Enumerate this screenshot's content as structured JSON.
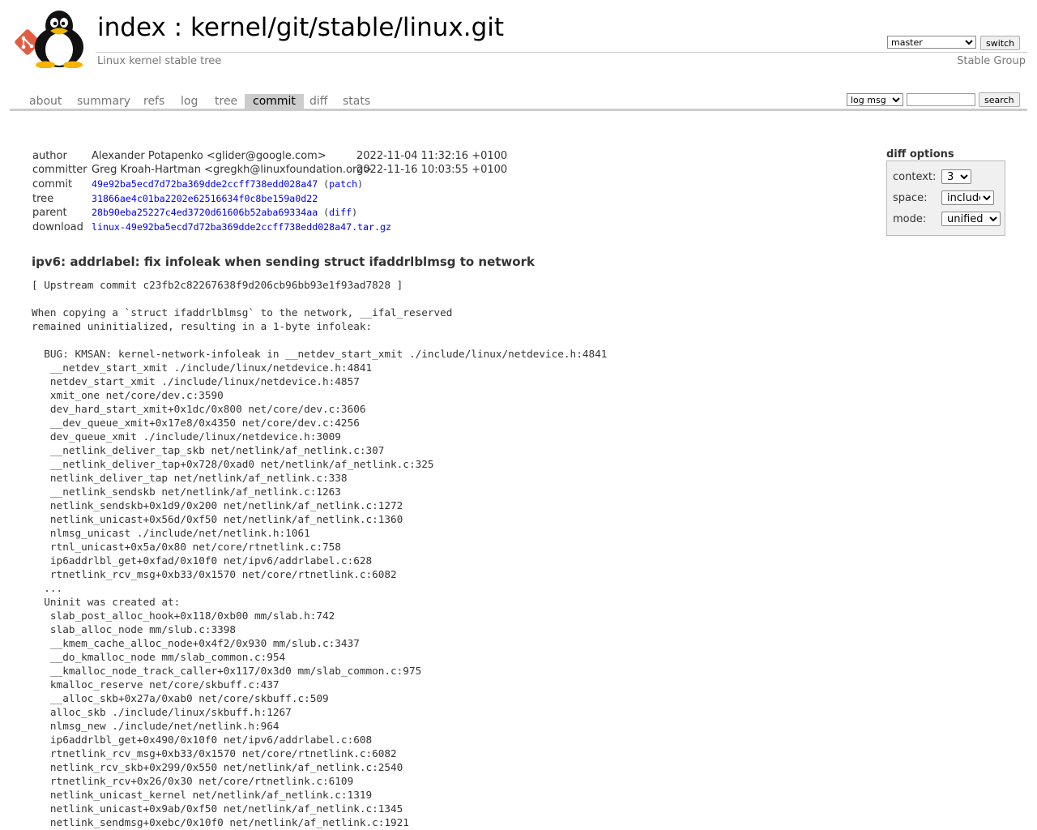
{
  "header": {
    "title_index": "index",
    "title_separator": " : ",
    "title_repo": "kernel/git/stable/linux.git",
    "description": "Linux kernel stable tree",
    "owner": "Stable Group",
    "branch_selected": "master",
    "switch_label": "switch"
  },
  "tabs": [
    {
      "label": "about"
    },
    {
      "label": "summary"
    },
    {
      "label": "refs"
    },
    {
      "label": "log"
    },
    {
      "label": "tree"
    },
    {
      "label": "commit",
      "active": true
    },
    {
      "label": "diff"
    },
    {
      "label": "stats"
    }
  ],
  "search": {
    "type_selected": "log msg",
    "query": "",
    "button_label": "search"
  },
  "commit_info": {
    "author_label": "author",
    "author": "Alexander Potapenko <glider@google.com>",
    "author_date": "2022-11-04 11:32:16 +0100",
    "committer_label": "committer",
    "committer": "Greg Kroah-Hartman <gregkh@linuxfoundation.org>",
    "committer_date": "2022-11-16 10:03:55 +0100",
    "commit_label": "commit",
    "commit_hash": "49e92ba5ecd7d72ba369dde2ccff738edd028a47",
    "commit_open": " (",
    "commit_link": "patch",
    "commit_close": ")",
    "tree_label": "tree",
    "tree_hash": "31866ae4c01ba2202e62516634f0c8be159a0d22",
    "parent_label": "parent",
    "parent_hash": "28b90eba25227c4ed3720d61606b52aba69334aa",
    "parent_open": " (",
    "parent_link": "diff",
    "parent_close": ")",
    "download_label": "download",
    "download_link": "linux-49e92ba5ecd7d72ba369dde2ccff738edd028a47.tar.gz"
  },
  "diff_options": {
    "title": "diff options",
    "context_label": "context:",
    "context_value": "3",
    "space_label": "space:",
    "space_value": "include",
    "mode_label": "mode:",
    "mode_value": "unified"
  },
  "message": {
    "subject": "ipv6: addrlabel: fix infoleak when sending struct ifaddrlblmsg to network",
    "body": "[ Upstream commit c23fb2c82267638f9d206cb96bb93e1f93ad7828 ]\n\nWhen copying a `struct ifaddrlblmsg` to the network, __ifal_reserved\nremained uninitialized, resulting in a 1-byte infoleak:\n\n  BUG: KMSAN: kernel-network-infoleak in __netdev_start_xmit ./include/linux/netdevice.h:4841\n   __netdev_start_xmit ./include/linux/netdevice.h:4841\n   netdev_start_xmit ./include/linux/netdevice.h:4857\n   xmit_one net/core/dev.c:3590\n   dev_hard_start_xmit+0x1dc/0x800 net/core/dev.c:3606\n   __dev_queue_xmit+0x17e8/0x4350 net/core/dev.c:4256\n   dev_queue_xmit ./include/linux/netdevice.h:3009\n   __netlink_deliver_tap_skb net/netlink/af_netlink.c:307\n   __netlink_deliver_tap+0x728/0xad0 net/netlink/af_netlink.c:325\n   netlink_deliver_tap net/netlink/af_netlink.c:338\n   __netlink_sendskb net/netlink/af_netlink.c:1263\n   netlink_sendskb+0x1d9/0x200 net/netlink/af_netlink.c:1272\n   netlink_unicast+0x56d/0xf50 net/netlink/af_netlink.c:1360\n   nlmsg_unicast ./include/net/netlink.h:1061\n   rtnl_unicast+0x5a/0x80 net/core/rtnetlink.c:758\n   ip6addrlbl_get+0xfad/0x10f0 net/ipv6/addrlabel.c:628\n   rtnetlink_rcv_msg+0xb33/0x1570 net/core/rtnetlink.c:6082\n  ...\n  Uninit was created at:\n   slab_post_alloc_hook+0x118/0xb00 mm/slab.h:742\n   slab_alloc_node mm/slub.c:3398\n   __kmem_cache_alloc_node+0x4f2/0x930 mm/slub.c:3437\n   __do_kmalloc_node mm/slab_common.c:954\n   __kmalloc_node_track_caller+0x117/0x3d0 mm/slab_common.c:975\n   kmalloc_reserve net/core/skbuff.c:437\n   __alloc_skb+0x27a/0xab0 net/core/skbuff.c:509\n   alloc_skb ./include/linux/skbuff.h:1267\n   nlmsg_new ./include/net/netlink.h:964\n   ip6addrlbl_get+0x490/0x10f0 net/ipv6/addrlabel.c:608\n   rtnetlink_rcv_msg+0xb33/0x1570 net/core/rtnetlink.c:6082\n   netlink_rcv_skb+0x299/0x550 net/netlink/af_netlink.c:2540\n   rtnetlink_rcv+0x26/0x30 net/core/rtnetlink.c:6109\n   netlink_unicast_kernel net/netlink/af_netlink.c:1319\n   netlink_unicast+0x9ab/0xf50 net/netlink/af_netlink.c:1345\n   netlink_sendmsg+0xebc/0x10f0 net/netlink/af_netlink.c:1921"
  },
  "colors": {
    "link": "#0000ee",
    "tab_active_bg": "#cccccc",
    "muted_text": "#777777",
    "git_logo": "#e05d44"
  }
}
